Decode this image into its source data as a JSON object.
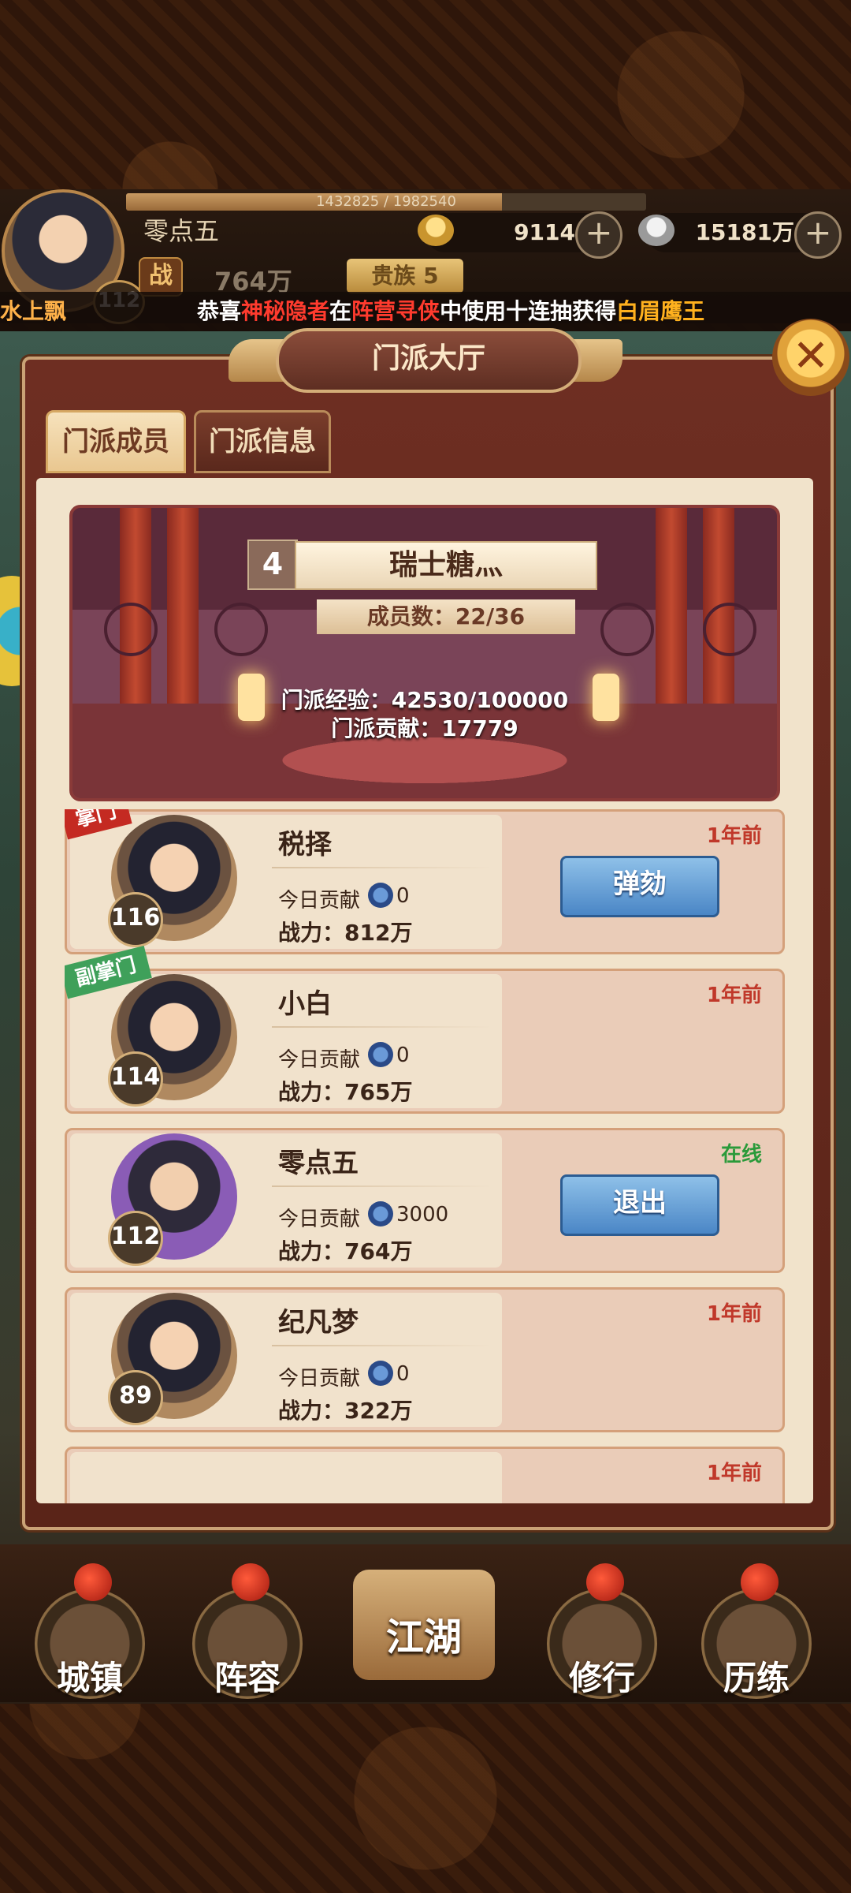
{
  "player": {
    "name": "零点五",
    "level": "112",
    "exp_text": "1432825 / 1982540",
    "exp_fraction": 0.7227,
    "power_icon_label": "战",
    "power": "764万",
    "noble": "贵族 5"
  },
  "currencies": {
    "gold": "9114",
    "silver": "15181万",
    "plus_label": "+"
  },
  "marquee": {
    "left_fragment": "水上飘",
    "prefix": "恭喜",
    "user": "神秘隐者",
    "mid1": "在",
    "activity": "阵营寻侠",
    "mid2": "中使用十连抽获得",
    "reward": "白眉鹰王"
  },
  "dialog": {
    "title": "门派大厅",
    "close_label": "✕",
    "tabs": [
      {
        "label": "门派成员",
        "active": true
      },
      {
        "label": "门派信息",
        "active": false
      }
    ]
  },
  "sect": {
    "rank": "4",
    "name": "瑞士糖灬",
    "member_count": "成员数：22/36",
    "exp": "门派经验：42530/100000",
    "contribution": "门派贡献：17779"
  },
  "members": [
    {
      "name": "税择",
      "level": "116",
      "role": "掌门",
      "contrib_label": "今日贡献",
      "contrib": "0",
      "power": "战力：812万",
      "status": "1年前",
      "action": "弹劾"
    },
    {
      "name": "小白",
      "level": "114",
      "role": "副掌门",
      "contrib_label": "今日贡献",
      "contrib": "0",
      "power": "战力：765万",
      "status": "1年前",
      "action": ""
    },
    {
      "name": "零点五",
      "level": "112",
      "role": "",
      "contrib_label": "今日贡献",
      "contrib": "3000",
      "power": "战力：764万",
      "status": "在线",
      "action": "退出"
    },
    {
      "name": "纪凡梦",
      "level": "89",
      "role": "",
      "contrib_label": "今日贡献",
      "contrib": "0",
      "power": "战力：322万",
      "status": "1年前",
      "action": ""
    }
  ],
  "partial_member_status": "1年前",
  "bottom_nav": [
    {
      "label": "城镇"
    },
    {
      "label": "阵容"
    },
    {
      "label": "江湖"
    },
    {
      "label": "修行"
    },
    {
      "label": "历练"
    }
  ],
  "colors": {
    "leader_tag": "#c42a22",
    "vice_tag": "#3fa05a",
    "status_away": "#c0382a",
    "status_online": "#2a9a3a",
    "action_button": "#4a86c6"
  }
}
